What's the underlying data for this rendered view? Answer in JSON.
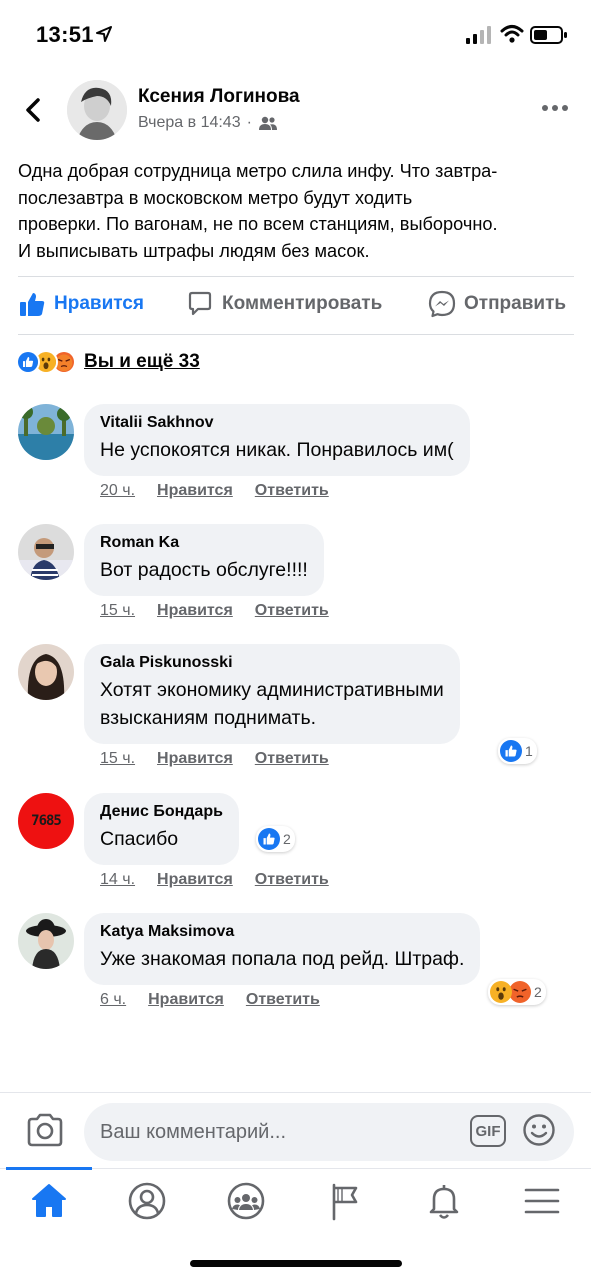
{
  "status_bar": {
    "time": "13:51"
  },
  "post": {
    "author": "Ксения Логинова",
    "timestamp": "Вчера в 14:43",
    "separator": "·",
    "text_lines": [
      "Одна добрая сотрудница метро слила инфу. Что завтра-",
      "послезавтра в московском метро будут ходить",
      "проверки. По вагонам, не по всем станциям, выборочно.",
      "И выписывать штрафы людям без масок."
    ]
  },
  "actions": {
    "like": "Нравится",
    "comment": "Комментировать",
    "share": "Отправить"
  },
  "reactions": {
    "types": [
      "like",
      "wow",
      "angry"
    ],
    "summary": "Вы и ещё 33"
  },
  "comments": [
    {
      "name": "Vitalii Sakhnov",
      "text_lines": [
        "Не успокоятся никак. Понравилось им("
      ],
      "time": "20 ч.",
      "like_label": "Нравится",
      "reply_label": "Ответить"
    },
    {
      "name": "Roman Ka",
      "text_lines": [
        "Вот радость обслуге!!!!"
      ],
      "time": "15 ч.",
      "like_label": "Нравится",
      "reply_label": "Ответить"
    },
    {
      "name": "Gala Piskunosski",
      "text_lines": [
        "Хотят экономику административными",
        "взысканиям поднимать."
      ],
      "time": "15 ч.",
      "like_label": "Нравится",
      "reply_label": "Ответить",
      "reaction_count": "1"
    },
    {
      "name": "Денис Бондарь",
      "text_lines": [
        "Спасибо"
      ],
      "time": "14 ч.",
      "like_label": "Нравится",
      "reply_label": "Ответить",
      "reaction_count": "2",
      "avatar_text": "7685"
    },
    {
      "name": "Katya Maksimova",
      "text_lines": [
        "Уже знакомая попала под рейд. Штраф."
      ],
      "time": "6 ч.",
      "like_label": "Нравится",
      "reply_label": "Ответить",
      "reaction_count": "2"
    }
  ],
  "composer": {
    "placeholder": "Ваш комментарий...",
    "gif_label": "GIF"
  },
  "tabs": [
    "home-icon",
    "profile-icon",
    "groups-icon",
    "pages-flag-icon",
    "notifications-bell-icon",
    "menu-icon"
  ],
  "colors": {
    "accent": "#1877f2",
    "bubble": "#f0f2f5",
    "secondary_text": "#65676b",
    "angry": "#f0632a",
    "wow": "#f7b125"
  }
}
